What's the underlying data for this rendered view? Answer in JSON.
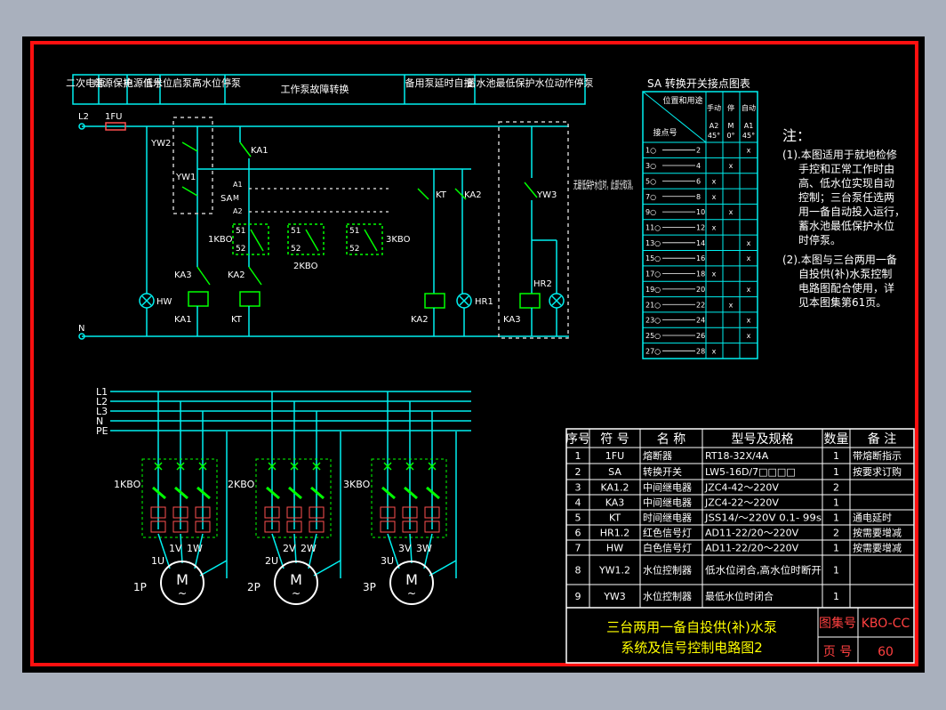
{
  "colors": {
    "background": "#000000",
    "border": "#ff1010",
    "wire": "#00f0f0",
    "component": "#00ff00",
    "dashed": "#c8c8c8",
    "text": "#ffffff",
    "title_text": "#ffff00",
    "fuse": "#ff5050"
  },
  "control": {
    "header": [
      "二次电源",
      "电源保护",
      "电源信号",
      "低水位启泵高水位停泵",
      "工作泵故障转换",
      "备用泵延时自投",
      "蓄水池最低保护水位动作停泵"
    ],
    "top_labels": {
      "l2": "L2",
      "fuse": "1FU",
      "n": "N"
    },
    "switches": {
      "yw2": "YW2",
      "yw1": "YW1",
      "ka1": "KA1",
      "sa": "SA",
      "a1": "A1",
      "m": "M",
      "a2": "A2",
      "kt": "KT",
      "ka2": "KA2",
      "yw3": "YW3"
    },
    "blocks": {
      "kbo1": "1KBO",
      "kbo2": "2KBO",
      "kbo3": "3KBO",
      "pin51": "51",
      "pin52": "52"
    },
    "coils": {
      "ka3": "KA3",
      "ka2": "KA2",
      "hw": "HW",
      "ka1": "KA1",
      "kt": "KT",
      "ka2b": "KA2",
      "hr1": "HR1",
      "ka3b": "KA3",
      "hr2": "HR2"
    },
    "note": "无最低保护水位时，此部分取消。"
  },
  "sa_table": {
    "title": "SA 转换开关接点图表",
    "header_diag_top": "位置和用途",
    "header_diag_bottom": "接点号",
    "col_positions": [
      "手动",
      "停",
      "自动"
    ],
    "col_symbols": [
      "A2",
      "M",
      "A1"
    ],
    "col_angles": [
      "45°",
      "0°",
      "45°"
    ],
    "rows": [
      {
        "contact": "1○—2",
        "marks": [
          "",
          "",
          "x"
        ]
      },
      {
        "contact": "3○—4",
        "marks": [
          "",
          "x",
          ""
        ]
      },
      {
        "contact": "5○—6",
        "marks": [
          "x",
          "",
          ""
        ]
      },
      {
        "contact": "7○—8",
        "marks": [
          "x",
          "",
          ""
        ]
      },
      {
        "contact": "9○—10",
        "marks": [
          "",
          "x",
          ""
        ]
      },
      {
        "contact": "11○—12",
        "marks": [
          "x",
          "",
          ""
        ]
      },
      {
        "contact": "13○—14",
        "marks": [
          "",
          "",
          "x"
        ]
      },
      {
        "contact": "15○—16",
        "marks": [
          "",
          "",
          "x"
        ]
      },
      {
        "contact": "17○—18",
        "marks": [
          "x",
          "",
          ""
        ]
      },
      {
        "contact": "19○—20",
        "marks": [
          "",
          "",
          "x"
        ]
      },
      {
        "contact": "21○—22",
        "marks": [
          "",
          "x",
          ""
        ]
      },
      {
        "contact": "23○—24",
        "marks": [
          "",
          "",
          "x"
        ]
      },
      {
        "contact": "25○—26",
        "marks": [
          "",
          "",
          "x"
        ]
      },
      {
        "contact": "27○—28",
        "marks": [
          "x",
          "",
          ""
        ]
      }
    ]
  },
  "notes": {
    "title": "注：",
    "items": [
      [
        "(1).本图适用于就地检修",
        "手控和正常工作时由",
        "高、低水位实现自动",
        "控制；三台泵任选两",
        "用一备自动投入运行，",
        "蓄水池最低保护水位",
        "时停泵。"
      ],
      [
        "(2).本图与三台两用一备",
        "自投供(补)水泵控制",
        "电路图配合使用，详",
        "见本图集第61页。"
      ]
    ]
  },
  "power": {
    "buses": [
      "L1",
      "L2",
      "L3",
      "N",
      "PE"
    ],
    "units": [
      {
        "kbo": "1KBO",
        "u": "1U",
        "v": "1V",
        "w": "1W",
        "pump": "1P"
      },
      {
        "kbo": "2KBO",
        "u": "2U",
        "v": "2V",
        "w": "2W",
        "pump": "2P"
      },
      {
        "kbo": "3KBO",
        "u": "3U",
        "v": "3V",
        "w": "3W",
        "pump": "3P"
      }
    ],
    "motor_symbol": "M",
    "motor_tilde": "~"
  },
  "bom": {
    "headers": [
      "序号",
      "符 号",
      "名 称",
      "型号及规格",
      "数量",
      "备 注"
    ],
    "rows": [
      [
        "1",
        "1FU",
        "熔断器",
        "RT18-32X/4A",
        "1",
        "带熔断指示"
      ],
      [
        "2",
        "SA",
        "转换开关",
        "LW5-16D/7□□□□",
        "1",
        "按要求订购"
      ],
      [
        "3",
        "KA1.2",
        "中间继电器",
        "JZC4-42～220V",
        "2",
        ""
      ],
      [
        "4",
        "KA3",
        "中间继电器",
        "JZC4-22～220V",
        "1",
        ""
      ],
      [
        "5",
        "KT",
        "时间继电器",
        "JSS14/～220V 0.1- 99s",
        "1",
        "通电延时"
      ],
      [
        "6",
        "HR1.2",
        "红色信号灯",
        "AD11-22/20～220V",
        "2",
        "按需要增减"
      ],
      [
        "7",
        "HW",
        "白色信号灯",
        "AD11-22/20～220V",
        "1",
        "按需要增减"
      ],
      [
        "8",
        "YW1.2",
        "水位控制器",
        "低水位闭合,高水位时断开",
        "1",
        ""
      ],
      [
        "9",
        "YW3",
        "水位控制器",
        "最低水位时闭合",
        "1",
        ""
      ]
    ],
    "title_line1": "三台两用一备自投供(补)水泵",
    "title_line2": "系统及信号控制电路图2",
    "atlas_label": "图集号",
    "atlas_value": "KBO-CC",
    "page_label": "页 号",
    "page_value": "60"
  }
}
